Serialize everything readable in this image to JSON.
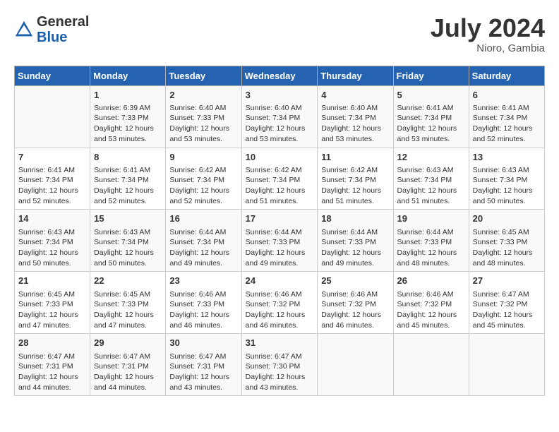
{
  "header": {
    "logo_general": "General",
    "logo_blue": "Blue",
    "month_year": "July 2024",
    "location": "Nioro, Gambia"
  },
  "days_of_week": [
    "Sunday",
    "Monday",
    "Tuesday",
    "Wednesday",
    "Thursday",
    "Friday",
    "Saturday"
  ],
  "weeks": [
    [
      {
        "day": "",
        "content": ""
      },
      {
        "day": "1",
        "content": "Sunrise: 6:39 AM\nSunset: 7:33 PM\nDaylight: 12 hours and 53 minutes."
      },
      {
        "day": "2",
        "content": "Sunrise: 6:40 AM\nSunset: 7:33 PM\nDaylight: 12 hours and 53 minutes."
      },
      {
        "day": "3",
        "content": "Sunrise: 6:40 AM\nSunset: 7:34 PM\nDaylight: 12 hours and 53 minutes."
      },
      {
        "day": "4",
        "content": "Sunrise: 6:40 AM\nSunset: 7:34 PM\nDaylight: 12 hours and 53 minutes."
      },
      {
        "day": "5",
        "content": "Sunrise: 6:41 AM\nSunset: 7:34 PM\nDaylight: 12 hours and 53 minutes."
      },
      {
        "day": "6",
        "content": "Sunrise: 6:41 AM\nSunset: 7:34 PM\nDaylight: 12 hours and 52 minutes."
      }
    ],
    [
      {
        "day": "7",
        "content": "Sunrise: 6:41 AM\nSunset: 7:34 PM\nDaylight: 12 hours and 52 minutes."
      },
      {
        "day": "8",
        "content": "Sunrise: 6:41 AM\nSunset: 7:34 PM\nDaylight: 12 hours and 52 minutes."
      },
      {
        "day": "9",
        "content": "Sunrise: 6:42 AM\nSunset: 7:34 PM\nDaylight: 12 hours and 52 minutes."
      },
      {
        "day": "10",
        "content": "Sunrise: 6:42 AM\nSunset: 7:34 PM\nDaylight: 12 hours and 51 minutes."
      },
      {
        "day": "11",
        "content": "Sunrise: 6:42 AM\nSunset: 7:34 PM\nDaylight: 12 hours and 51 minutes."
      },
      {
        "day": "12",
        "content": "Sunrise: 6:43 AM\nSunset: 7:34 PM\nDaylight: 12 hours and 51 minutes."
      },
      {
        "day": "13",
        "content": "Sunrise: 6:43 AM\nSunset: 7:34 PM\nDaylight: 12 hours and 50 minutes."
      }
    ],
    [
      {
        "day": "14",
        "content": "Sunrise: 6:43 AM\nSunset: 7:34 PM\nDaylight: 12 hours and 50 minutes."
      },
      {
        "day": "15",
        "content": "Sunrise: 6:43 AM\nSunset: 7:34 PM\nDaylight: 12 hours and 50 minutes."
      },
      {
        "day": "16",
        "content": "Sunrise: 6:44 AM\nSunset: 7:34 PM\nDaylight: 12 hours and 49 minutes."
      },
      {
        "day": "17",
        "content": "Sunrise: 6:44 AM\nSunset: 7:33 PM\nDaylight: 12 hours and 49 minutes."
      },
      {
        "day": "18",
        "content": "Sunrise: 6:44 AM\nSunset: 7:33 PM\nDaylight: 12 hours and 49 minutes."
      },
      {
        "day": "19",
        "content": "Sunrise: 6:44 AM\nSunset: 7:33 PM\nDaylight: 12 hours and 48 minutes."
      },
      {
        "day": "20",
        "content": "Sunrise: 6:45 AM\nSunset: 7:33 PM\nDaylight: 12 hours and 48 minutes."
      }
    ],
    [
      {
        "day": "21",
        "content": "Sunrise: 6:45 AM\nSunset: 7:33 PM\nDaylight: 12 hours and 47 minutes."
      },
      {
        "day": "22",
        "content": "Sunrise: 6:45 AM\nSunset: 7:33 PM\nDaylight: 12 hours and 47 minutes."
      },
      {
        "day": "23",
        "content": "Sunrise: 6:46 AM\nSunset: 7:33 PM\nDaylight: 12 hours and 46 minutes."
      },
      {
        "day": "24",
        "content": "Sunrise: 6:46 AM\nSunset: 7:32 PM\nDaylight: 12 hours and 46 minutes."
      },
      {
        "day": "25",
        "content": "Sunrise: 6:46 AM\nSunset: 7:32 PM\nDaylight: 12 hours and 46 minutes."
      },
      {
        "day": "26",
        "content": "Sunrise: 6:46 AM\nSunset: 7:32 PM\nDaylight: 12 hours and 45 minutes."
      },
      {
        "day": "27",
        "content": "Sunrise: 6:47 AM\nSunset: 7:32 PM\nDaylight: 12 hours and 45 minutes."
      }
    ],
    [
      {
        "day": "28",
        "content": "Sunrise: 6:47 AM\nSunset: 7:31 PM\nDaylight: 12 hours and 44 minutes."
      },
      {
        "day": "29",
        "content": "Sunrise: 6:47 AM\nSunset: 7:31 PM\nDaylight: 12 hours and 44 minutes."
      },
      {
        "day": "30",
        "content": "Sunrise: 6:47 AM\nSunset: 7:31 PM\nDaylight: 12 hours and 43 minutes."
      },
      {
        "day": "31",
        "content": "Sunrise: 6:47 AM\nSunset: 7:30 PM\nDaylight: 12 hours and 43 minutes."
      },
      {
        "day": "",
        "content": ""
      },
      {
        "day": "",
        "content": ""
      },
      {
        "day": "",
        "content": ""
      }
    ]
  ]
}
